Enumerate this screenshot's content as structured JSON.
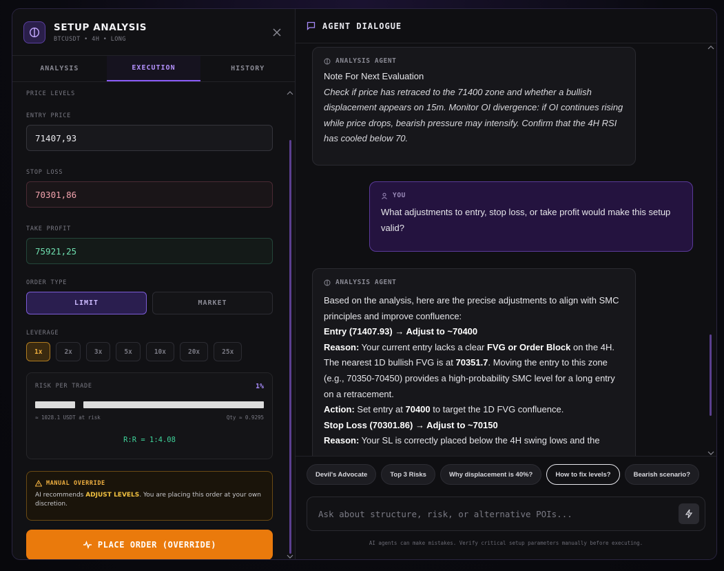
{
  "panel": {
    "title": "SETUP ANALYSIS",
    "subtitle": "BTCUSDT • 4H • LONG"
  },
  "tabs": [
    {
      "label": "ANALYSIS",
      "active": false
    },
    {
      "label": "EXECUTION",
      "active": true
    },
    {
      "label": "HISTORY",
      "active": false
    }
  ],
  "execution": {
    "section_label": "PRICE LEVELS",
    "entry_label": "ENTRY PRICE",
    "entry_value": "71407,93",
    "sl_label": "STOP LOSS",
    "sl_value": "70301,86",
    "tp_label": "TAKE PROFIT",
    "tp_value": "75921,25",
    "order_type_label": "ORDER TYPE",
    "order_types": [
      "LIMIT",
      "MARKET"
    ],
    "order_type_selected": "LIMIT",
    "leverage_label": "LEVERAGE",
    "leverage_options": [
      "1x",
      "2x",
      "3x",
      "5x",
      "10x",
      "20x",
      "25x"
    ],
    "leverage_selected": "1x",
    "risk_label": "RISK PER TRADE",
    "risk_pct": "1%",
    "risk_amount": "≈ 1028.1 USDT at risk",
    "qty": "Qty ≈ 0.9295",
    "rr": "R:R = 1:4.08",
    "override_title": "MANUAL OVERRIDE",
    "override_text_pre": "AI recommends ",
    "override_text_bold": "ADJUST LEVELS",
    "override_text_post": ". You are placing this order at your own discretion.",
    "place_order_label": "PLACE ORDER (OVERRIDE)"
  },
  "dialogue": {
    "title": "AGENT DIALOGUE",
    "agent_name": "ANALYSIS AGENT",
    "user_name": "YOU",
    "msg1_heading": "Note For Next Evaluation",
    "msg1_body": "Check if price has retraced to the 71400 zone and whether a bullish displacement appears on 15m. Monitor OI divergence: if OI continues rising while price drops, bearish pressure may intensify. Confirm that the 4H RSI has cooled below 70.",
    "msg2_body": "What adjustments to entry, stop loss, or take profit would make this setup valid?",
    "msg3_intro": "Based on the analysis, here are the precise adjustments to align with SMC principles and improve confluence:",
    "msg3_entry_head": "Entry (71407.93) → Adjust to ~70400",
    "msg3_reason_label": "Reason:",
    "msg3_reason1_a": " Your current entry lacks a clear ",
    "msg3_reason1_b": "FVG or Order Block",
    "msg3_reason1_c": " on the 4H. The nearest 1D bullish FVG is at ",
    "msg3_reason1_d": "70351.7",
    "msg3_reason1_e": ". Moving the entry to this zone (e.g., 70350-70450) provides a high-probability SMC level for a long entry on a retracement.",
    "msg3_action_label": "Action:",
    "msg3_action_a": " Set entry at ",
    "msg3_action_b": "70400",
    "msg3_action_c": " to target the 1D FVG confluence.",
    "msg3_sl_head": "Stop Loss (70301.86) → Adjust to ~70150",
    "msg3_reason2": " Your SL is correctly placed below the 4H swing lows and the",
    "chips": [
      "Devil's Advocate",
      "Top 3 Risks",
      "Why displacement is 40%?",
      "How to fix levels?",
      "Bearish scenario?"
    ],
    "chip_active": "How to fix levels?",
    "input_placeholder": "Ask about structure, risk, or alternative POIs...",
    "disclaimer": "AI agents can make mistakes. Verify critical setup parameters manually before executing."
  },
  "colors": {
    "accent": "#8b5cf6",
    "order_button": "#ea7a0c",
    "take_profit": "#6fe0b0",
    "stop_loss": "#f3a3ae",
    "warning": "#f0b040"
  }
}
